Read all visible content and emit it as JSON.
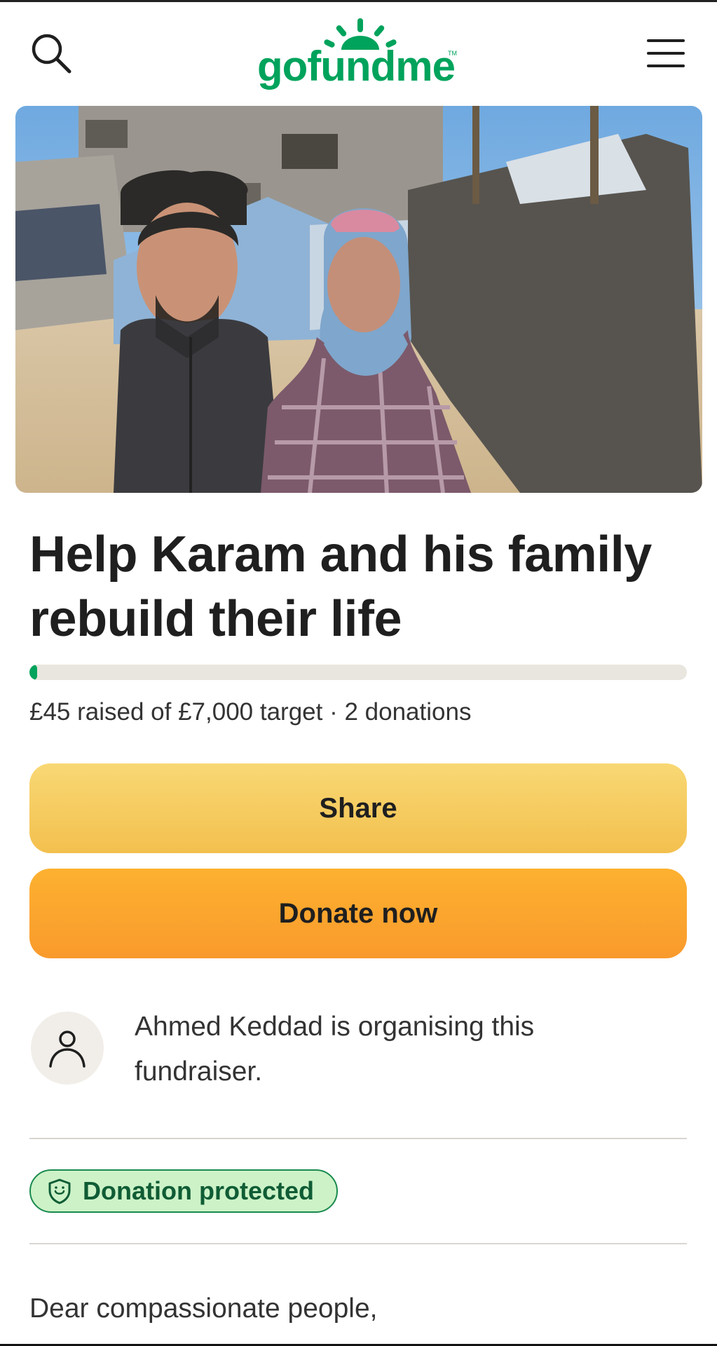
{
  "header": {
    "logo_text": "gofundme",
    "logo_tm": "TM",
    "search_icon": "search-icon",
    "menu_icon": "hamburger-menu-icon",
    "brand_color": "#00a35c"
  },
  "campaign": {
    "title": "Help Karam and his family rebuild their life",
    "progress_fraction": 0.0064,
    "raised_text": "£45 raised of £7,000 target · 2 donations"
  },
  "actions": {
    "share_label": "Share",
    "donate_label": "Donate now"
  },
  "organiser": {
    "avatar_icon": "person-icon",
    "text": "Ahmed Keddad is organising this fundraiser."
  },
  "badge": {
    "icon": "shield-icon",
    "label": "Donation protected"
  },
  "story": {
    "opening": "Dear compassionate people,"
  }
}
